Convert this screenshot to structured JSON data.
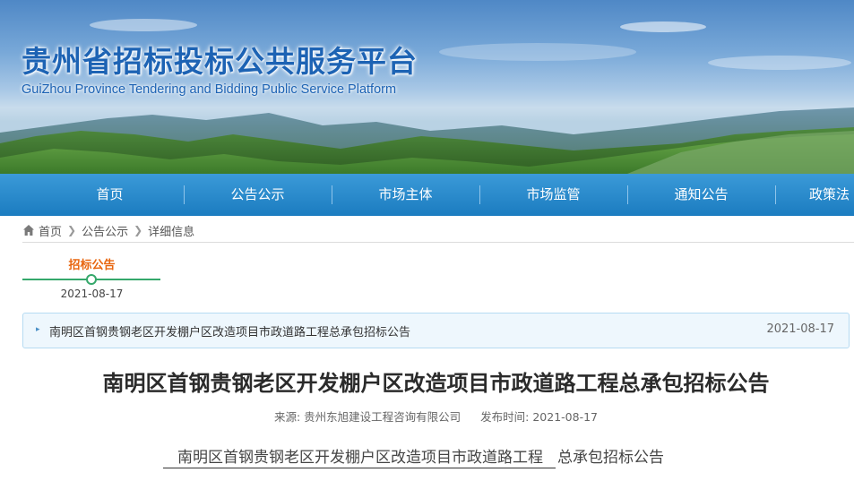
{
  "header": {
    "title": "贵州省招标投标公共服务平台",
    "subtitle": "GuiZhou Province Tendering and Bidding Public Service Platform"
  },
  "nav": {
    "items": [
      {
        "label": "首页"
      },
      {
        "label": "公告公示"
      },
      {
        "label": "市场主体"
      },
      {
        "label": "市场监管"
      },
      {
        "label": "通知公告"
      },
      {
        "label": "政策法"
      }
    ]
  },
  "breadcrumb": {
    "icon": "home-icon",
    "items": [
      "首页",
      "公告公示",
      "详细信息"
    ]
  },
  "timeline": {
    "label": "招标公告",
    "date": "2021-08-17"
  },
  "notice": {
    "title": "南明区首钢贵钢老区开发棚户区改造项目市政道路工程总承包招标公告",
    "date": "2021-08-17"
  },
  "article": {
    "title": "南明区首钢贵钢老区开发棚户区改造项目市政道路工程总承包招标公告",
    "source_label": "来源:",
    "source": "贵州东旭建设工程咨询有限公司",
    "published_label": "发布时间:",
    "published": "2021-08-17",
    "body_underlined": "南明区首钢贵钢老区开发棚户区改造项目市政道路工程",
    "body_rest": "总承包招标公告"
  },
  "colors": {
    "brand_blue": "#1d63b4",
    "nav_blue": "#1b7cc0",
    "accent_orange": "#e8650e",
    "timeline_green": "#35a86b"
  }
}
